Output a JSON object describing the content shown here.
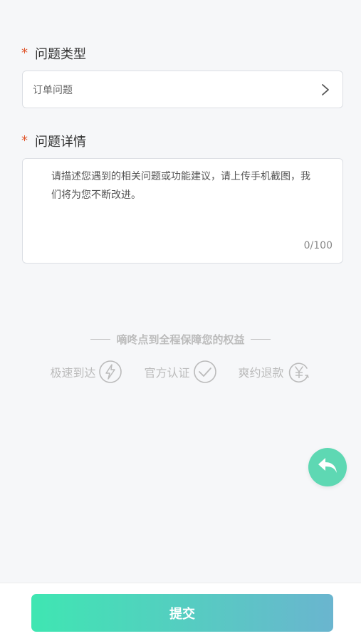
{
  "form": {
    "type_section": {
      "required_mark": "*",
      "label": "问题类型",
      "selected_value": "订单问题",
      "chevron_icon": "chevron-right-icon"
    },
    "detail_section": {
      "required_mark": "*",
      "label": "问题详情",
      "placeholder": "请描述您遇到的相关问题或功能建议，请上传手机截图，我们将为您不断改进。",
      "counter": "0/100"
    }
  },
  "guarantee": {
    "title": "嘀咚点到全程保障您的权益",
    "features": [
      {
        "label": "极速到达",
        "icon": "lightning-icon"
      },
      {
        "label": "官方认证",
        "icon": "check-circle-icon"
      },
      {
        "label": "爽约退款",
        "icon": "yen-refund-icon"
      }
    ]
  },
  "fab": {
    "icon": "reply-arrow-icon"
  },
  "footer": {
    "submit_label": "提交"
  },
  "colors": {
    "required": "#e0552b",
    "fab": "#5ed8b3",
    "button_gradient_start": "#3fe6b2",
    "button_gradient_end": "#6ab5cf"
  }
}
